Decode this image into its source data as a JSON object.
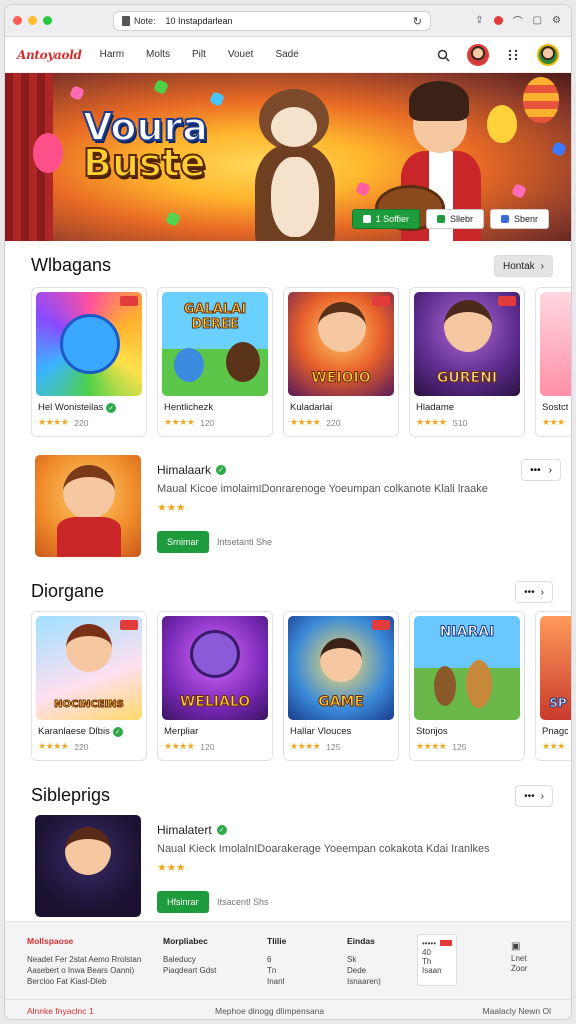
{
  "browser": {
    "tab_label": "Note:",
    "url": "10 Instapdarlean",
    "reload_icon": "reload-icon"
  },
  "nav": {
    "logo": "Antoyaold",
    "links": [
      "Harm",
      "Molts",
      "Pilt",
      "Vouet",
      "Sade"
    ]
  },
  "hero": {
    "title_line1": "Voura",
    "title_line2": "Buste",
    "btn_primary": "1 Soffier",
    "btn_secondary": "Sllebr",
    "btn_tertiary": "Sbenr"
  },
  "sections": [
    {
      "title": "Wlbagans",
      "more_label": "Hontak",
      "cards": [
        {
          "name": "Hel Wonisteilas",
          "rating": "★★★★",
          "meta": "220",
          "verified": true,
          "thumb_text": ""
        },
        {
          "name": "Hentlichezk",
          "rating": "★★★★",
          "meta": "120",
          "verified": false,
          "thumb_text": "GALALAI DEREE"
        },
        {
          "name": "Kuladarlai",
          "rating": "★★★★",
          "meta": "220",
          "verified": false,
          "thumb_text": "WEIOIO"
        },
        {
          "name": "Hladame",
          "rating": "★★★★",
          "meta": "S10",
          "verified": false,
          "thumb_text": "GURENI"
        },
        {
          "name": "Sostct",
          "rating": "★★★",
          "meta": "",
          "verified": false,
          "thumb_text": ""
        }
      ]
    },
    {
      "title": "Diorgane",
      "more_label": "•••",
      "cards": [
        {
          "name": "Karanlaese Dlbis",
          "rating": "★★★★",
          "meta": "220",
          "verified": true,
          "thumb_text": "NOCINCEINS"
        },
        {
          "name": "Merpliar",
          "rating": "★★★★",
          "meta": "120",
          "verified": false,
          "thumb_text": "WELIALO"
        },
        {
          "name": "Hallar Vlouces",
          "rating": "★★★★",
          "meta": "125",
          "verified": false,
          "thumb_text": "GAME"
        },
        {
          "name": "Stonjos",
          "rating": "★★★★",
          "meta": "125",
          "verified": false,
          "thumb_text": "NIARAI"
        },
        {
          "name": "Pnagcen",
          "rating": "★★★",
          "meta": "",
          "verified": false,
          "thumb_text": "SP"
        }
      ]
    },
    {
      "title": "Sibleprigs",
      "more_label": "•••"
    }
  ],
  "featured": [
    {
      "title": "Himalaark",
      "desc": "Maual Kicoe imolaimIDonrarenoge Yoeumpan colkanote Klali lraake",
      "rating": "★★★",
      "install": "Srnimar",
      "sub": "Intsetanti She"
    },
    {
      "title": "Himalatert",
      "desc": "Naual Kieck ImolalnIDoarakerage Yoeempan cokakota Kdai Iranlkes",
      "rating": "★★★",
      "install": "Hfsinrar",
      "sub": "Itsacentl Shs"
    }
  ],
  "footer": {
    "col1": {
      "title": "Mollspaose",
      "lines": [
        "Neadet Fer 2stat Aemo Rrolstan",
        "Aasebert o Inwa Bears Oanni)",
        "Bercloo Fat Kiasl-Dleb"
      ]
    },
    "col2": {
      "title": "Morpliabec",
      "lines": [
        "Baleducy",
        "Piaqdeart Gdst"
      ]
    },
    "col3": {
      "title": "Tlilie",
      "lines": [
        "6",
        "Tn",
        "Inanl"
      ]
    },
    "col4": {
      "title": "Eindas",
      "lines": [
        "Sk",
        "Dede",
        "Isnaaren)"
      ]
    },
    "box": {
      "top": "•••••",
      "l1": "40",
      "l2": "Th",
      "l3": "Isaan"
    },
    "col6": {
      "lines": [
        "Lnet",
        "Zoor"
      ]
    },
    "bottom_left": "Alnnke fnyaclnc 1",
    "bottom_center": "Mephoe dinogg dlimpensana",
    "bottom_right": "Maalacly  Newn  Ol"
  },
  "colors": {
    "accent": "#d32f2f",
    "install": "#1e9b3c",
    "star": "#f2a81d"
  }
}
